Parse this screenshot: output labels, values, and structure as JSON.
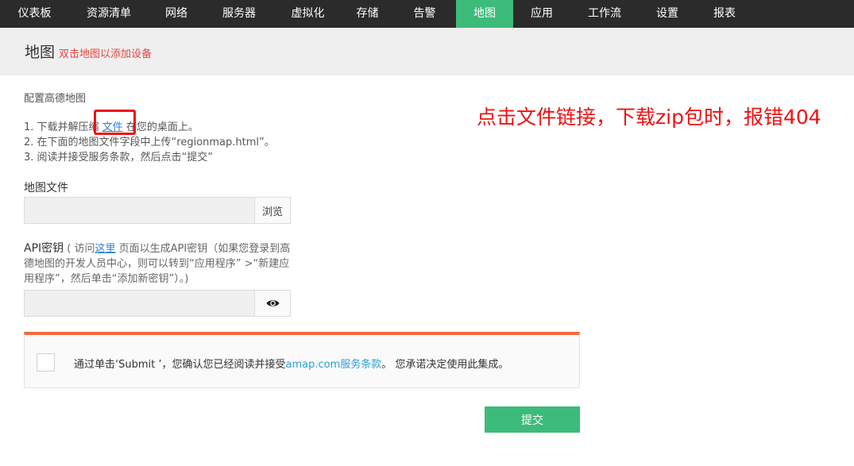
{
  "nav": {
    "items": [
      {
        "label": "仪表板",
        "active": false
      },
      {
        "label": "资源清单",
        "active": false
      },
      {
        "label": "网络",
        "active": false
      },
      {
        "label": "服务器",
        "active": false
      },
      {
        "label": "虚拟化",
        "active": false
      },
      {
        "label": "存储",
        "active": false
      },
      {
        "label": "告警",
        "active": false
      },
      {
        "label": "地图",
        "active": true
      },
      {
        "label": "应用",
        "active": false
      },
      {
        "label": "工作流",
        "active": false
      },
      {
        "label": "设置",
        "active": false
      },
      {
        "label": "报表",
        "active": false
      }
    ],
    "active_color": "#3dbb7a",
    "bg_color": "#2b2b2b"
  },
  "header": {
    "title": "地图",
    "subtitle": "双击地图以添加设备"
  },
  "config": {
    "section_title": "配置高德地图",
    "step1_prefix": "1. 下载并解压缩 ",
    "step1_link": "文件",
    "step1_suffix": " 在您的桌面上。",
    "step2": "2. 在下面的地图文件字段中上传“regionmap.html”。",
    "step3": "3. 阅读并接受服务条款，然后点击“提交”"
  },
  "annotation": {
    "text": "点击文件链接，下载zip包时，报错404",
    "color": "#ee1111"
  },
  "map_file": {
    "label": "地图文件",
    "value": "",
    "browse_label": "浏览"
  },
  "api_key": {
    "label": "API密钥",
    "help_prefix": " ( 访问",
    "help_link": "这里",
    "help_suffix": " 页面以生成API密钥（如果您登录到高德地图的开发人员中心，则可以转到“应用程序” >“新建应用程序”，然后单击“添加新密钥”）。)",
    "value": "",
    "toggle_icon": "eye-icon"
  },
  "terms": {
    "checked": false,
    "text_prefix": "通过单击‘Submit ’，您确认您已经阅读并接受",
    "link": "amap.com服务条款",
    "text_suffix": "。 您承诺决定使用此集成。",
    "accent_color": "#f06b3e"
  },
  "submit": {
    "label": "提交"
  }
}
